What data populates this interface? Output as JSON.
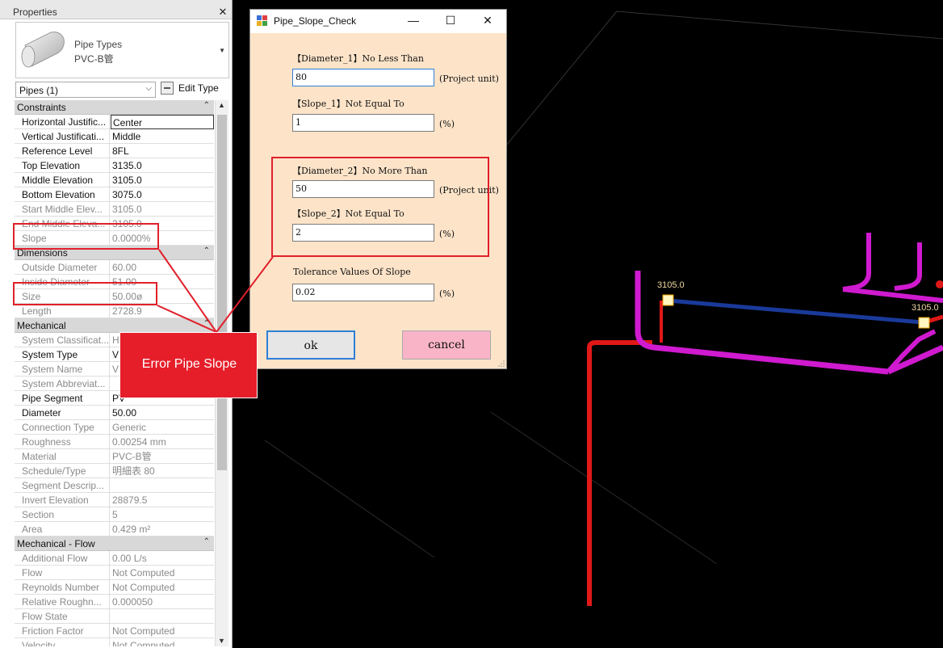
{
  "properties": {
    "title": "Properties",
    "close_glyph": "✕",
    "type_family": "Pipe Types",
    "type_name": "PVC-B管",
    "filter_label": "Pipes (1)",
    "edit_type_label": "Edit Type"
  },
  "sections": {
    "constraints": "Constraints",
    "dimensions": "Dimensions",
    "mechanical": "Mechanical",
    "mechanical_flow": "Mechanical - Flow"
  },
  "constraints": [
    {
      "name": "Horizontal Justific...",
      "value": "Center"
    },
    {
      "name": "Vertical Justificati...",
      "value": "Middle"
    },
    {
      "name": "Reference Level",
      "value": "8FL"
    },
    {
      "name": "Top Elevation",
      "value": "3135.0"
    },
    {
      "name": "Middle Elevation",
      "value": "3105.0"
    },
    {
      "name": "Bottom Elevation",
      "value": "3075.0"
    },
    {
      "name": "Start Middle Elev...",
      "value": "3105.0"
    },
    {
      "name": "End Middle Eleva...",
      "value": "3105.0"
    },
    {
      "name": "Slope",
      "value": "0.0000%"
    }
  ],
  "dimensions": [
    {
      "name": "Outside Diameter",
      "value": "60.00"
    },
    {
      "name": "Inside Diameter",
      "value": "51.00"
    },
    {
      "name": "Size",
      "value": "50.00ø"
    },
    {
      "name": "Length",
      "value": "2728.9"
    }
  ],
  "mechanical": [
    {
      "name": "System Classificat...",
      "value": "H"
    },
    {
      "name": "System Type",
      "value": "V"
    },
    {
      "name": "System Name",
      "value": "V"
    },
    {
      "name": "System Abbreviat...",
      "value": ""
    },
    {
      "name": "Pipe Segment",
      "value": "PV"
    },
    {
      "name": "Diameter",
      "value": "50.00"
    },
    {
      "name": "Connection Type",
      "value": "Generic"
    },
    {
      "name": "Roughness",
      "value": "0.00254 mm"
    },
    {
      "name": "Material",
      "value": "PVC-B管"
    },
    {
      "name": "Schedule/Type",
      "value": "明細表 80"
    },
    {
      "name": "Segment Descrip...",
      "value": ""
    },
    {
      "name": "Invert Elevation",
      "value": "28879.5"
    },
    {
      "name": "Section",
      "value": "5"
    },
    {
      "name": "Area",
      "value": "0.429 m²"
    }
  ],
  "mechanical_flow": [
    {
      "name": "Additional Flow",
      "value": "0.00 L/s"
    },
    {
      "name": "Flow",
      "value": "Not Computed"
    },
    {
      "name": "Reynolds Number",
      "value": "Not Computed"
    },
    {
      "name": "Relative Roughn...",
      "value": "0.000050"
    },
    {
      "name": "Flow State",
      "value": ""
    },
    {
      "name": "Friction Factor",
      "value": "Not Computed"
    },
    {
      "name": "Velocity",
      "value": "Not Computed"
    }
  ],
  "dialog": {
    "title": "Pipe_Slope_Check",
    "minimize_glyph": "—",
    "maximize_glyph": "☐",
    "close_glyph": "✕",
    "diameter1_label": "【Diameter_1】No Less Than",
    "diameter1_value": "80",
    "diameter1_unit": "(Project unit)",
    "slope1_label": "【Slope_1】Not Equal To",
    "slope1_value": "1",
    "slope1_unit": "(%)",
    "diameter2_label": "【Diameter_2】No More Than",
    "diameter2_value": "50",
    "diameter2_unit": "(Project unit)",
    "slope2_label": "【Slope_2】Not Equal To",
    "slope2_value": "2",
    "slope2_unit": "(%)",
    "tolerance_label": "Tolerance Values Of Slope",
    "tolerance_value": "0.02",
    "tolerance_unit": "(%)",
    "ok_label": "ok",
    "cancel_label": "cancel"
  },
  "annotation": {
    "callout_text": "Error Pipe Slope",
    "accent_color": "#e61e2a"
  },
  "viewport": {
    "tag_left": "3105.0",
    "tag_right": "3105.0"
  },
  "colors": {
    "dialog_bg": "#fde4c9",
    "cancel_bg": "#f9b4c8",
    "pipe_magenta": "#d01ad0",
    "pipe_red": "#e01818",
    "pipe_blue": "#1a3a9a"
  }
}
